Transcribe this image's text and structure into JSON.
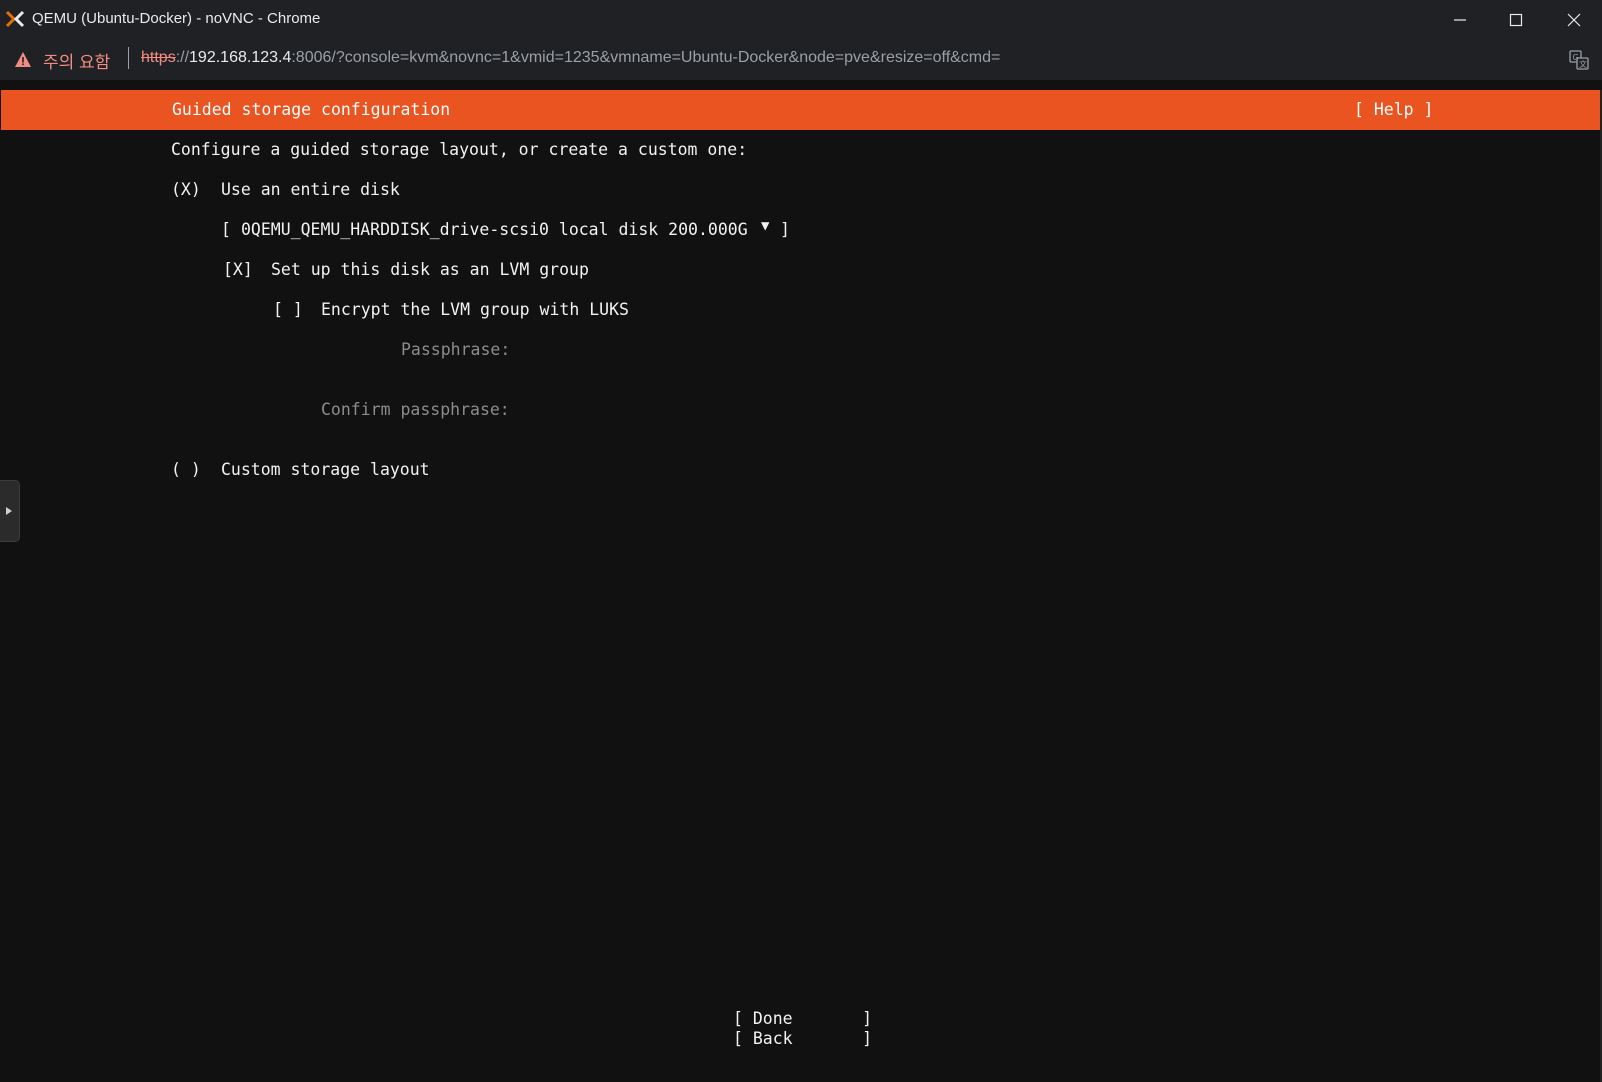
{
  "window": {
    "title": "QEMU (Ubuntu-Docker) - noVNC - Chrome"
  },
  "addressbar": {
    "security_warning": "주의 요함",
    "url_scheme": "https",
    "url_sep": "://",
    "url_host": "192.168.123.4",
    "url_rest": ":8006/?console=kvm&novnc=1&vmid=1235&vmname=Ubuntu-Docker&node=pve&resize=off&cmd="
  },
  "installer": {
    "header_title": "Guided storage configuration",
    "help_label": "[ Help ]",
    "prompt": "Configure a guided storage layout, or create a custom one:",
    "option_entire_disk": {
      "marker": "(X)",
      "label": "Use an entire disk"
    },
    "disk_select": {
      "open": "[",
      "value": "0QEMU_QEMU_HARDDISK_drive-scsi0 local disk 200.000G",
      "arrow": "▼",
      "close": "]"
    },
    "lvm_checkbox": {
      "marker": "[X]",
      "label": "Set up this disk as an LVM group"
    },
    "luks_checkbox": {
      "marker": "[ ]",
      "label": "Encrypt the LVM group with LUKS"
    },
    "passphrase_label": "Passphrase:",
    "confirm_passphrase_label": "Confirm passphrase:",
    "option_custom": {
      "marker": "( )",
      "label": "Custom storage layout"
    },
    "done_button": "[ Done       ]",
    "back_button": "[ Back       ]"
  },
  "colors": {
    "accent_orange": "#e95420",
    "console_bg": "#111111",
    "chrome_bg": "#202124",
    "warning_red": "#f28b82"
  },
  "icons": {
    "app": "proxmox-x-icon",
    "warning": "warning-triangle-icon",
    "translate": "translate-icon",
    "minimize": "minimize-icon",
    "maximize": "maximize-icon",
    "close": "close-icon",
    "sidebar": "sidebar-expand-icon"
  }
}
